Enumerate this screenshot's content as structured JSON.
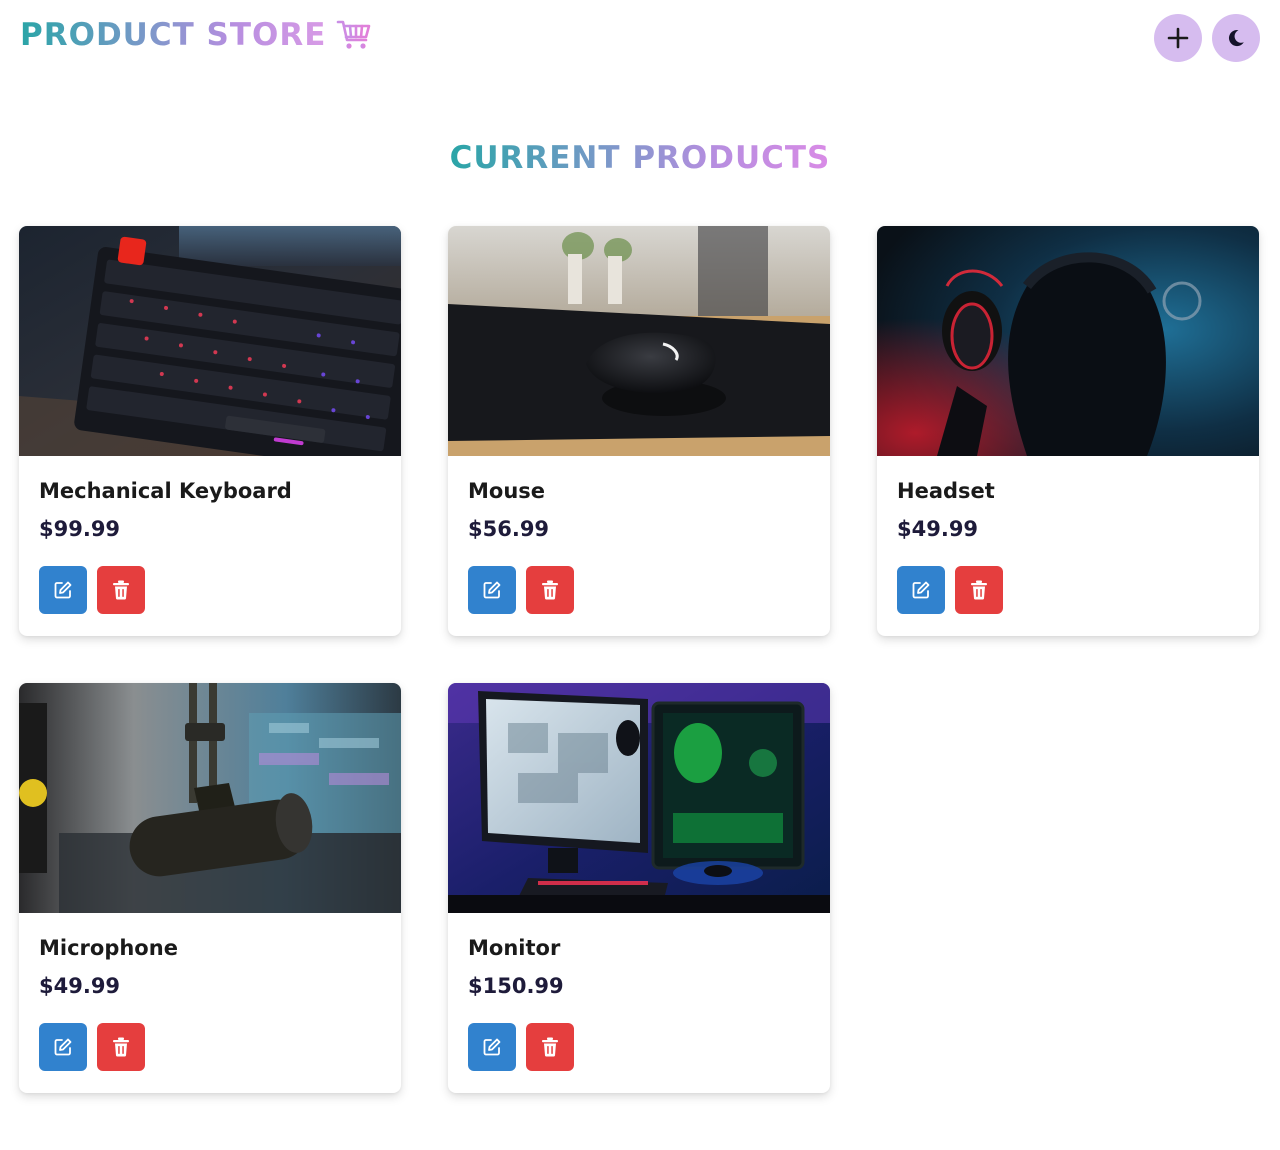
{
  "header": {
    "brand": "PRODUCT STORE",
    "brand_icon": "shopping-cart-icon",
    "actions": [
      {
        "name": "create-product-button",
        "icon": "plus-icon"
      },
      {
        "name": "color-mode-toggle",
        "icon": "moon-icon"
      }
    ]
  },
  "main": {
    "title": "CURRENT PRODUCTS"
  },
  "products": [
    {
      "name": "Mechanical Keyboard",
      "price": "$99.99",
      "image": "keyboard-photo"
    },
    {
      "name": "Mouse",
      "price": "$56.99",
      "image": "mouse-photo"
    },
    {
      "name": "Headset",
      "price": "$49.99",
      "image": "headset-photo"
    },
    {
      "name": "Microphone",
      "price": "$49.99",
      "image": "microphone-photo"
    },
    {
      "name": "Monitor",
      "price": "$150.99",
      "image": "monitor-photo"
    }
  ],
  "colors": {
    "accent_gradient_start": "#2aa5a7",
    "accent_gradient_end": "#d98be6",
    "nav_button_bg": "#d6bcef",
    "edit_button": "#3182ce",
    "delete_button": "#e53e3e"
  }
}
